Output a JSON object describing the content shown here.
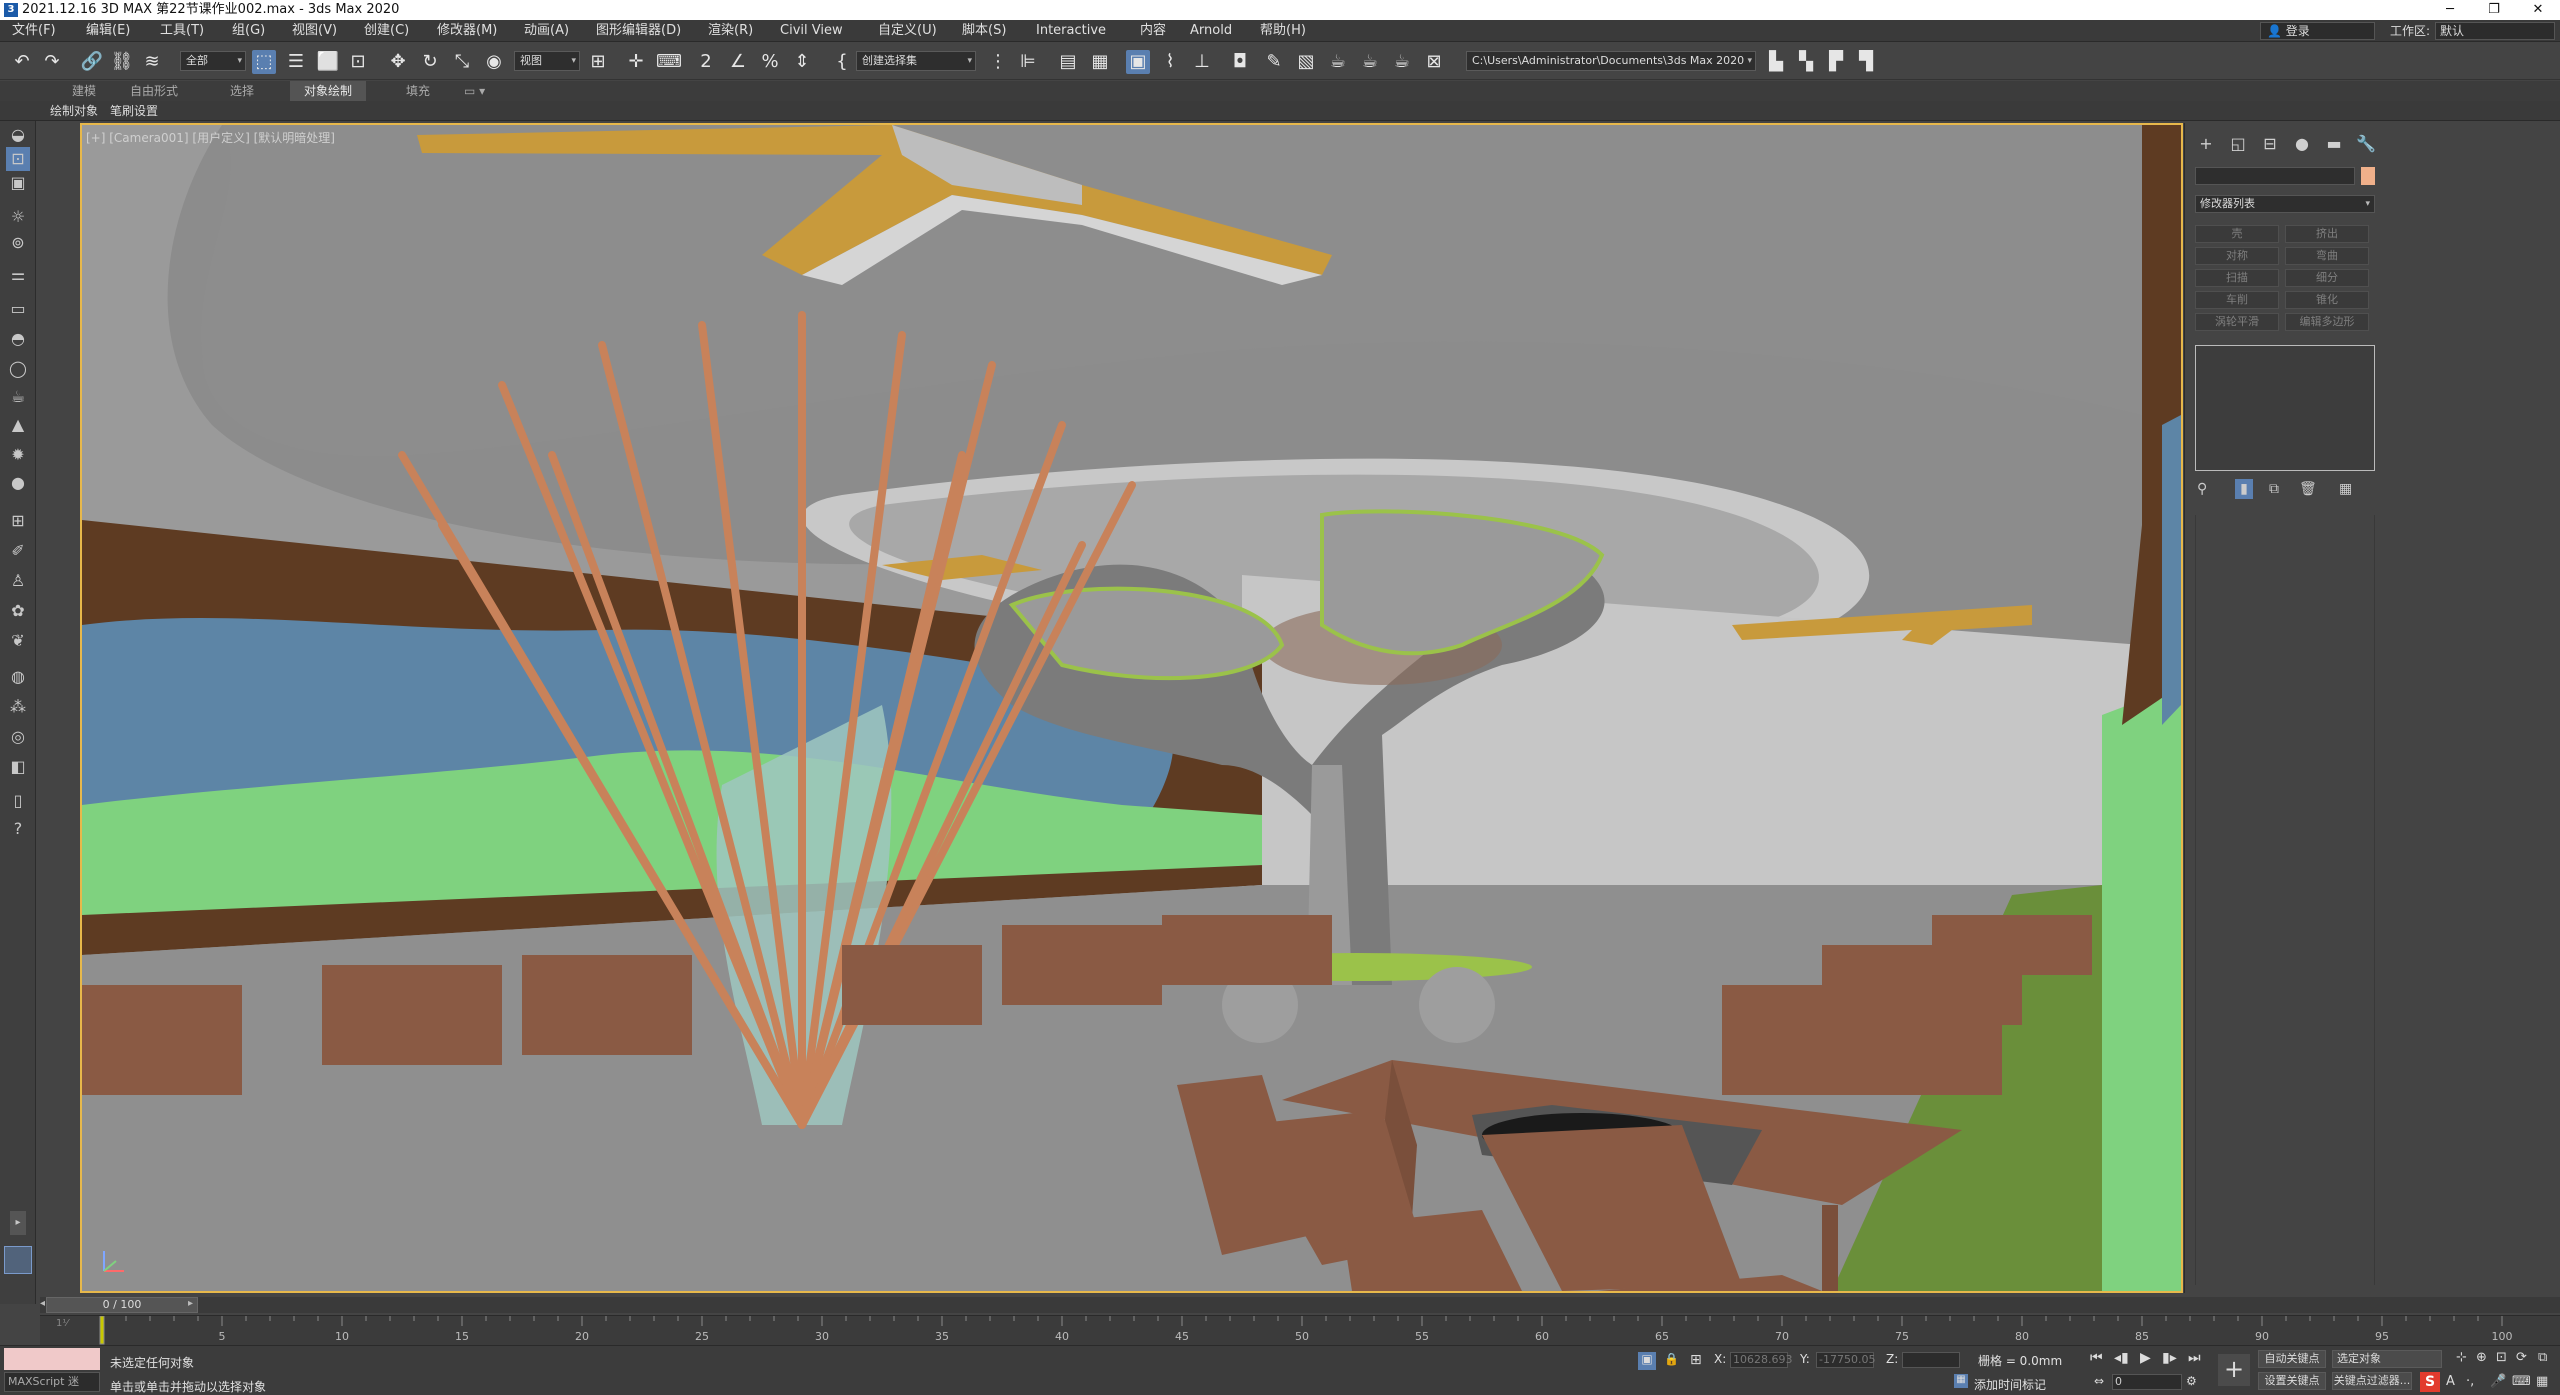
{
  "title_bar": {
    "title": "2021.12.16 3D MAX 第22节课作业002.max - 3ds Max 2020",
    "minimize": "─",
    "restore": "❐",
    "close": "✕"
  },
  "menu": [
    "文件(F)",
    "编辑(E)",
    "工具(T)",
    "组(G)",
    "视图(V)",
    "创建(C)",
    "修改器(M)",
    "动画(A)",
    "图形编辑器(D)",
    "渲染(R)",
    "Civil View",
    "自定义(U)",
    "脚本(S)",
    "Interactive",
    "内容",
    "Arnold",
    "帮助(H)"
  ],
  "login": "登录",
  "workspace": {
    "label": "工作区:",
    "value": "默认"
  },
  "toolbar": {
    "filter": "全部",
    "ref_coord": "视图",
    "named_selection": "创建选择集",
    "path": "C:\\Users\\Administrator\\Documents\\3ds Max 2020"
  },
  "ribbon": {
    "tabs": [
      "建模",
      "自由形式",
      "选择",
      "对象绘制",
      "填充"
    ],
    "active_tab": "对象绘制",
    "sub_tabs": [
      "绘制对象",
      "笔刷设置"
    ]
  },
  "viewport": {
    "label": "[+] [Camera001] [用户定义] [默认明暗处理]"
  },
  "command_panel": {
    "modifier_list": "修改器列表",
    "modifier_buttons": [
      "壳",
      "挤出",
      "对称",
      "弯曲",
      "扫描",
      "细分",
      "车削",
      "锥化",
      "涡轮平滑",
      "编辑多边形"
    ],
    "colors": {
      "object_color": "#f0b08a"
    }
  },
  "timeline": {
    "frame": "0 / 100",
    "ticks": [
      "5",
      "10",
      "15",
      "20",
      "25",
      "30",
      "35",
      "40",
      "45",
      "50",
      "55",
      "60",
      "65",
      "70",
      "75",
      "80",
      "85",
      "90",
      "95",
      "100"
    ]
  },
  "status": {
    "maxscript": "MAXScript 迷",
    "message1": "未选定任何对象",
    "message2": "单击或单击并拖动以选择对象",
    "x_label": "X:",
    "x_value": "10628.693",
    "y_label": "Y:",
    "y_value": "-17750.05",
    "z_label": "Z:",
    "z_value": "",
    "grid": "栅格 = 0.0mm",
    "add_time_tag": "添加时间标记",
    "auto_key": "自动关键点",
    "set_key": "设置关键点",
    "selected_object": "选定对象",
    "key_filter": "关键点过滤器...",
    "frame_field": "0"
  }
}
